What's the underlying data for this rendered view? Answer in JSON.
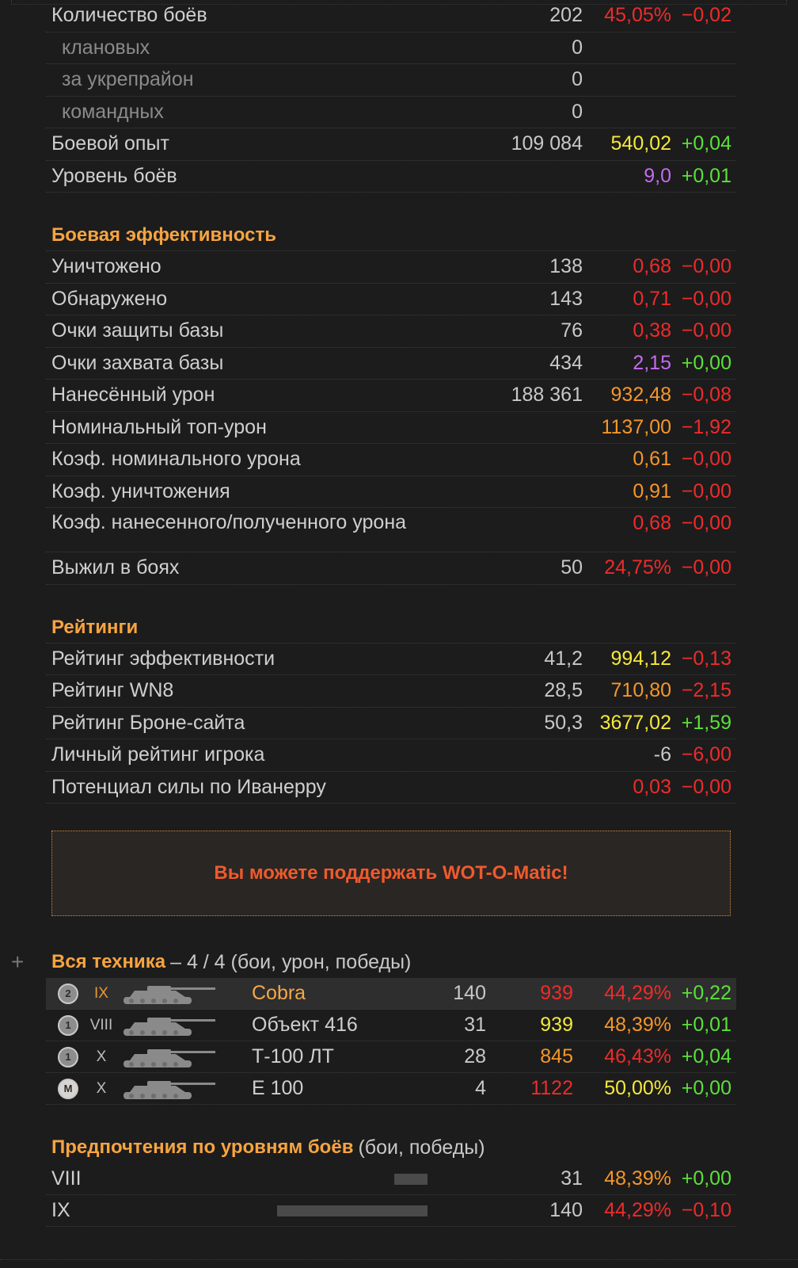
{
  "general": [
    {
      "label": "Количество боёв",
      "count": "202",
      "rate": "45,05%",
      "rate_color": "red",
      "delta": "−0,02",
      "delta_color": "red",
      "sub": false
    },
    {
      "label": "клановых",
      "count": "0",
      "rate": "",
      "rate_color": "",
      "delta": "",
      "delta_color": "",
      "sub": true
    },
    {
      "label": "за укрепрайон",
      "count": "0",
      "rate": "",
      "rate_color": "",
      "delta": "",
      "delta_color": "",
      "sub": true
    },
    {
      "label": "командных",
      "count": "0",
      "rate": "",
      "rate_color": "",
      "delta": "",
      "delta_color": "",
      "sub": true
    },
    {
      "label": "Боевой опыт",
      "count": "109 084",
      "rate": "540,02",
      "rate_color": "yellow",
      "delta": "+0,04",
      "delta_color": "green",
      "sub": false
    },
    {
      "label": "Уровень боёв",
      "count": "",
      "rate": "9,0",
      "rate_color": "purple",
      "delta": "+0,01",
      "delta_color": "green",
      "sub": false
    }
  ],
  "efficiency": {
    "title": "Боевая эффективность",
    "rows": [
      {
        "label": "Уничтожено",
        "count": "138",
        "rate": "0,68",
        "rate_color": "red",
        "delta": "−0,00",
        "delta_color": "red"
      },
      {
        "label": "Обнаружено",
        "count": "143",
        "rate": "0,71",
        "rate_color": "red",
        "delta": "−0,00",
        "delta_color": "red"
      },
      {
        "label": "Очки защиты базы",
        "count": "76",
        "rate": "0,38",
        "rate_color": "red",
        "delta": "−0,00",
        "delta_color": "red"
      },
      {
        "label": "Очки захвата базы",
        "count": "434",
        "rate": "2,15",
        "rate_color": "purple",
        "delta": "+0,00",
        "delta_color": "green"
      },
      {
        "label": "Нанесённый урон",
        "count": "188 361",
        "rate": "932,48",
        "rate_color": "orange",
        "delta": "−0,08",
        "delta_color": "red"
      },
      {
        "label": "Номинальный топ-урон",
        "count": "",
        "rate": "1137,00",
        "rate_color": "orange",
        "delta": "−1,92",
        "delta_color": "red"
      },
      {
        "label": "Коэф. номинального урона",
        "count": "",
        "rate": "0,61",
        "rate_color": "orange",
        "delta": "−0,00",
        "delta_color": "red"
      },
      {
        "label": "Коэф. уничтожения",
        "count": "",
        "rate": "0,91",
        "rate_color": "orange",
        "delta": "−0,00",
        "delta_color": "red"
      },
      {
        "label": "Коэф. нанесенного/полученного урона",
        "count": "",
        "rate": "0,68",
        "rate_color": "red",
        "delta": "−0,00",
        "delta_color": "red",
        "tall": true
      },
      {
        "label": "Выжил в боях",
        "count": "50",
        "rate": "24,75%",
        "rate_color": "red",
        "delta": "−0,00",
        "delta_color": "red"
      }
    ]
  },
  "ratings": {
    "title": "Рейтинги",
    "rows": [
      {
        "label": "Рейтинг эффективности",
        "count": "41,2",
        "rate": "994,12",
        "rate_color": "yellow",
        "delta": "−0,13",
        "delta_color": "red"
      },
      {
        "label": "Рейтинг WN8",
        "count": "28,5",
        "rate": "710,80",
        "rate_color": "orange",
        "delta": "−2,15",
        "delta_color": "red"
      },
      {
        "label": "Рейтинг Броне-сайта",
        "count": "50,3",
        "rate": "3677,02",
        "rate_color": "yellow",
        "delta": "+1,59",
        "delta_color": "green"
      },
      {
        "label": "Личный рейтинг игрока",
        "count": "",
        "rate": "-6",
        "rate_color": "plain",
        "delta": "−6,00",
        "delta_color": "red"
      },
      {
        "label": "Потенциал силы по Иванерру",
        "count": "",
        "rate": "0,03",
        "rate_color": "red",
        "delta": "−0,00",
        "delta_color": "red"
      }
    ]
  },
  "banner": {
    "text": "Вы можете поддержать WOT-O-Matic!"
  },
  "vehicles": {
    "expand_icon": "+",
    "title": "Вся техника",
    "subtitle": "– 4 / 4 (бои, урон, победы)",
    "rows": [
      {
        "mark": "2",
        "tier": "IX",
        "name": "Cobra",
        "battles": "140",
        "damage": "939",
        "damage_color": "red",
        "winrate": "44,29%",
        "winrate_color": "red",
        "delta": "+0,22",
        "delta_color": "green",
        "highlight": true
      },
      {
        "mark": "1",
        "tier": "VIII",
        "name": "Объект 416",
        "battles": "31",
        "damage": "939",
        "damage_color": "yellow",
        "winrate": "48,39%",
        "winrate_color": "orange",
        "delta": "+0,01",
        "delta_color": "green",
        "highlight": false
      },
      {
        "mark": "1",
        "tier": "X",
        "name": "Т-100 ЛТ",
        "battles": "28",
        "damage": "845",
        "damage_color": "orange",
        "winrate": "46,43%",
        "winrate_color": "red",
        "delta": "+0,04",
        "delta_color": "green",
        "highlight": false
      },
      {
        "mark": "M",
        "tier": "X",
        "name": "E 100",
        "battles": "4",
        "damage": "1122",
        "damage_color": "red",
        "winrate": "50,00%",
        "winrate_color": "yellow",
        "delta": "+0,00",
        "delta_color": "green",
        "highlight": false
      }
    ]
  },
  "preferences": {
    "title": "Предпочтения по уровням боёв",
    "subtitle": "(бои, победы)",
    "rows": [
      {
        "level": "VIII",
        "battles": "31",
        "winrate": "48,39%",
        "winrate_color": "orange",
        "delta": "+0,00",
        "delta_color": "green",
        "share": 0.22
      },
      {
        "level": "IX",
        "battles": "140",
        "winrate": "44,29%",
        "winrate_color": "red",
        "delta": "−0,10",
        "delta_color": "red",
        "share": 1.0
      }
    ]
  }
}
